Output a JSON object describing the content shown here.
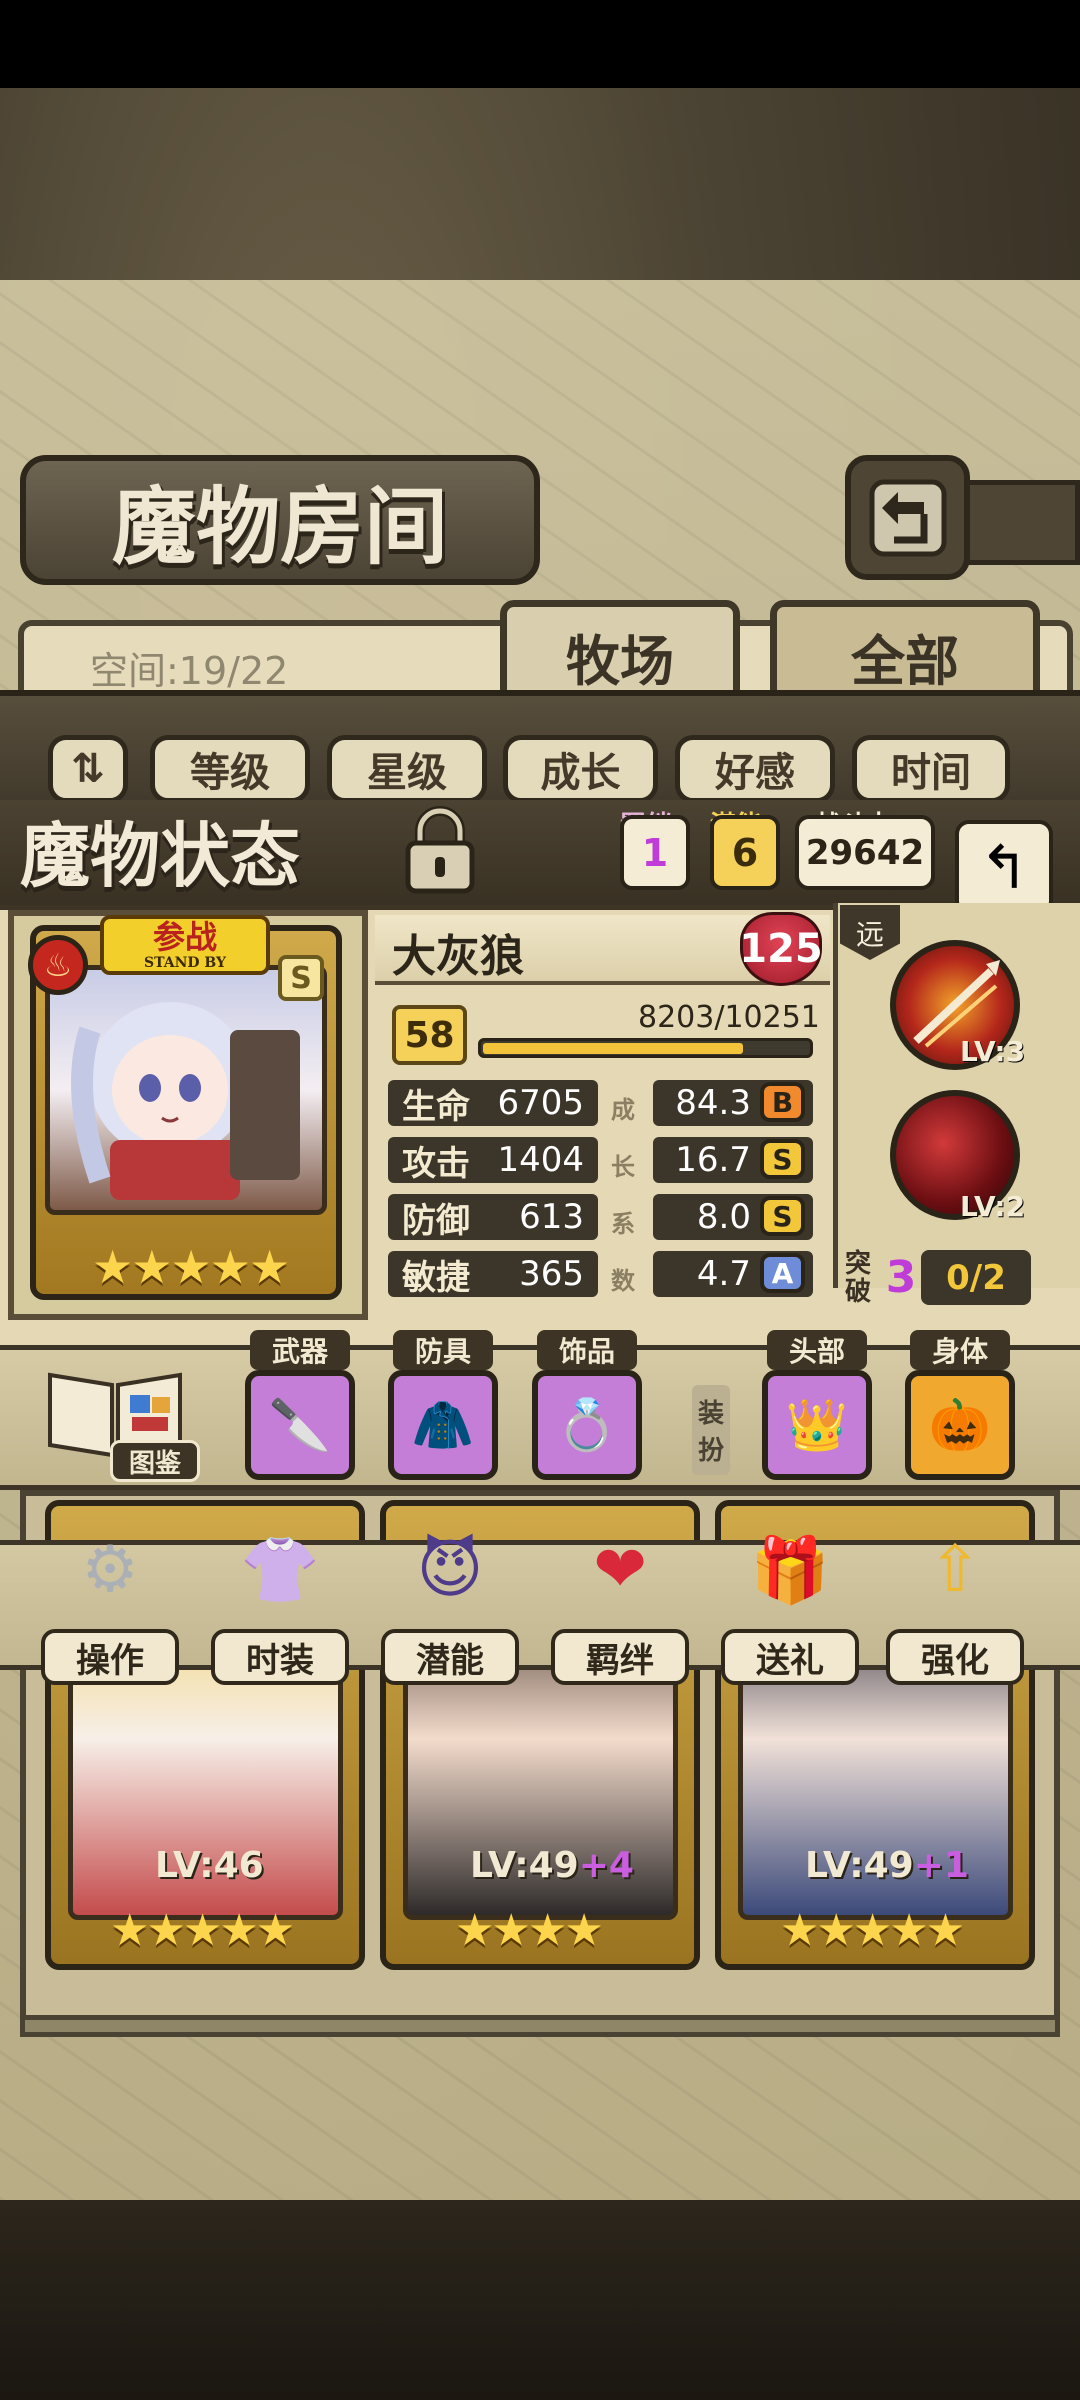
{
  "header": {
    "title": "魔物房间",
    "back_icon": "return-icon"
  },
  "filter": {
    "space": "空间:19/22",
    "tabs": [
      {
        "label": "牧场"
      },
      {
        "label": "全部"
      }
    ]
  },
  "sort": {
    "toggle_icon": "sort-toggle-icon",
    "buttons": [
      "等级",
      "星级",
      "成长",
      "好感",
      "时间"
    ]
  },
  "status": {
    "title": "魔物状态",
    "bond_label": "羁绊",
    "bond_value": "1",
    "potential_label": "潜能",
    "potential_value": "6",
    "power_label": "战斗力",
    "power_value": "29642"
  },
  "monster": {
    "name": "大灰狼",
    "affection": "125",
    "standby_cn": "参战",
    "standby_en": "STAND BY",
    "grade": "S",
    "stars": 5,
    "level": "58",
    "xp_text": "8203/10251",
    "xp_fraction": 0.8,
    "growth_label": [
      "成",
      "长",
      "系",
      "数"
    ],
    "stats": [
      {
        "label": "生命",
        "value": "6705",
        "growth": "84.3",
        "rank": "B"
      },
      {
        "label": "攻击",
        "value": "1404",
        "growth": "16.7",
        "rank": "S"
      },
      {
        "label": "防御",
        "value": "613",
        "growth": "8.0",
        "rank": "S"
      },
      {
        "label": "敏捷",
        "value": "365",
        "growth": "4.7",
        "rank": "A"
      }
    ],
    "range_label": "远",
    "skills": [
      {
        "level": "LV:3"
      },
      {
        "level": "LV:2"
      }
    ],
    "breakthrough_label": "突破",
    "breakthrough_value": "3",
    "breakthrough_progress": "0/2"
  },
  "equipment": {
    "codex_label": "图鉴",
    "dress_label": [
      "装",
      "扮"
    ],
    "slots": [
      {
        "label": "武器",
        "icon": "weapon-icon"
      },
      {
        "label": "防具",
        "icon": "armor-icon"
      },
      {
        "label": "饰品",
        "icon": "ring-icon"
      },
      {
        "label": "头部",
        "icon": "tiara-icon"
      },
      {
        "label": "身体",
        "icon": "pumpkin-icon"
      }
    ]
  },
  "actions": [
    {
      "label": "操作",
      "icon": "gear-icon"
    },
    {
      "label": "时装",
      "icon": "outfit-icon"
    },
    {
      "label": "潜能",
      "icon": "demon-icon"
    },
    {
      "label": "羁绊",
      "icon": "hearts-icon"
    },
    {
      "label": "送礼",
      "icon": "gift-icon"
    },
    {
      "label": "强化",
      "icon": "upgrade-icon"
    }
  ],
  "roster": [
    {
      "level": "LV:46",
      "plus": ""
    },
    {
      "level": "LV:49",
      "plus": "+4"
    },
    {
      "level": "LV:49",
      "plus": "+1"
    }
  ],
  "colors": {
    "accent": "#f3c33a",
    "rank_b": "#f08a2c",
    "rank_s": "#f2c73a",
    "rank_a": "#6e8cd8",
    "breakthrough": "#c03cd8"
  }
}
